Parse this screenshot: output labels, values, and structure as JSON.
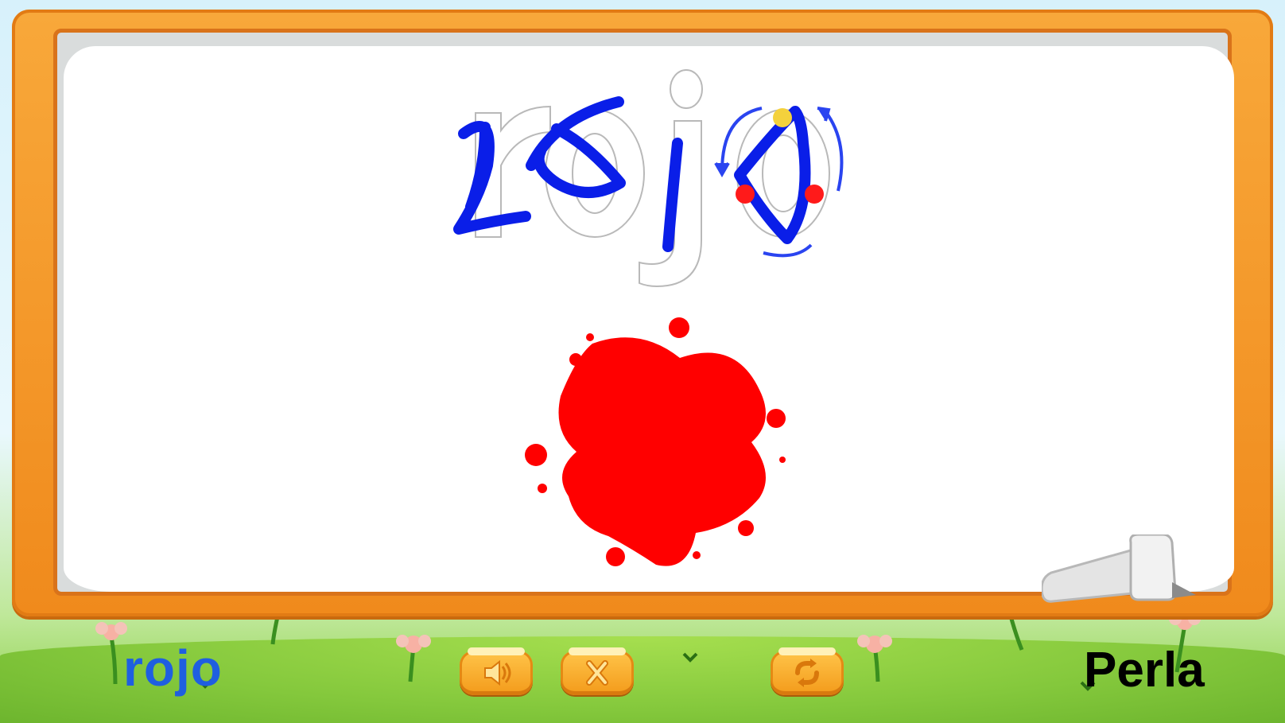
{
  "board": {
    "target_word": "rojo",
    "tracing_color": "#0a1ee8",
    "guide_outline_color": "#b9b9b9",
    "color_swatch": "#ff0000"
  },
  "footer": {
    "word_label": "rojo",
    "player_name": "Perla",
    "buttons": [
      {
        "name": "sound",
        "icon": "speaker-icon"
      },
      {
        "name": "clear",
        "icon": "close-icon"
      },
      {
        "name": "next",
        "icon": "refresh-icon"
      }
    ]
  },
  "colors": {
    "frame": "#f39a1a",
    "word_label": "#1f5fe0",
    "player_label": "#000000",
    "button": "#ffb534"
  }
}
